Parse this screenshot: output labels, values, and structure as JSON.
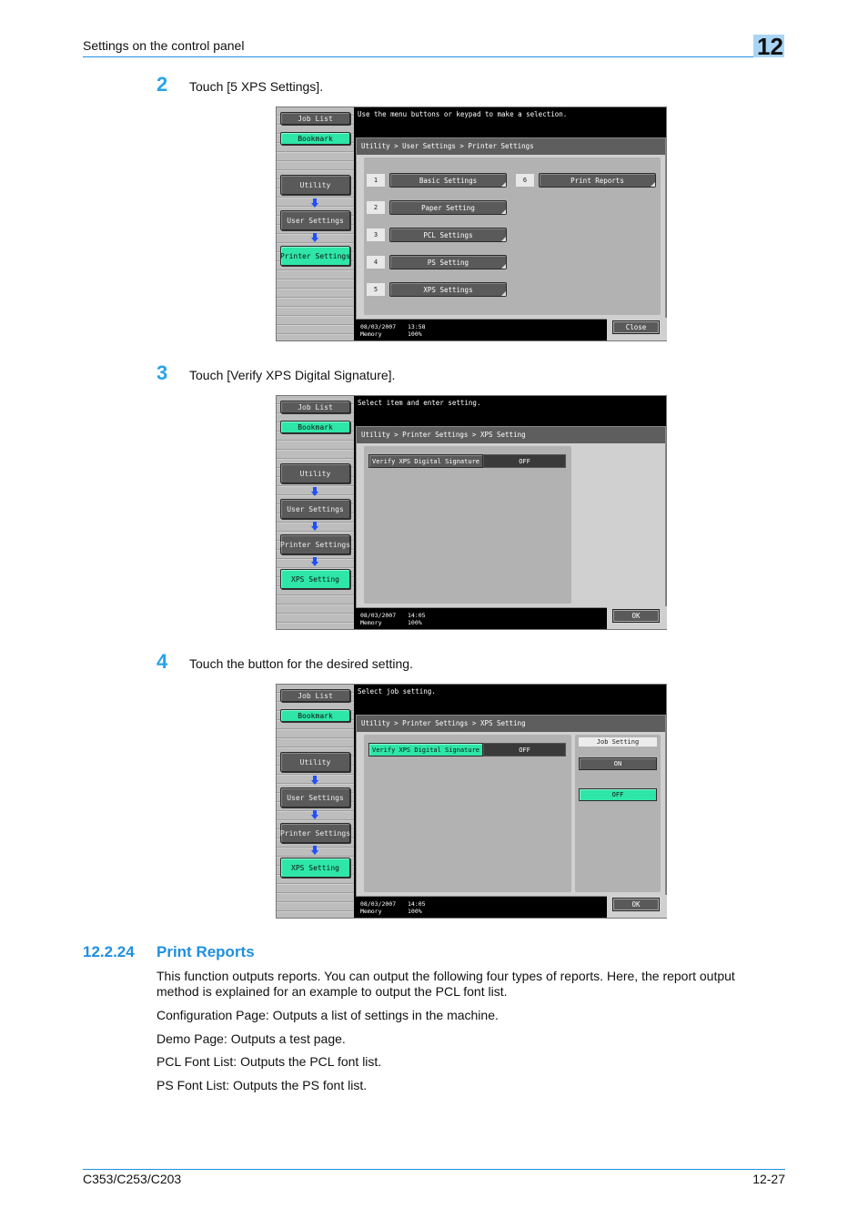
{
  "header": {
    "title": "Settings on the control panel",
    "chapter": "12"
  },
  "steps": [
    {
      "num": "2",
      "text": "Touch [5 XPS Settings]."
    },
    {
      "num": "3",
      "text": "Touch [Verify XPS Digital Signature]."
    },
    {
      "num": "4",
      "text": "Touch the button for the desired setting."
    }
  ],
  "screens": [
    {
      "message": "Use the menu buttons or keypad to make a selection.",
      "breadcrumb": "Utility > User Settings > Printer Settings",
      "sidebar": {
        "job_list": "Job List",
        "bookmark": "Bookmark",
        "path": [
          "Utility",
          "User Settings",
          "Printer Settings"
        ]
      },
      "menu": [
        {
          "num": "1",
          "label": "Basic Settings"
        },
        {
          "num": "2",
          "label": "Paper Setting"
        },
        {
          "num": "3",
          "label": "PCL Settings"
        },
        {
          "num": "4",
          "label": "PS Setting"
        },
        {
          "num": "5",
          "label": "XPS Settings"
        },
        {
          "num": "6",
          "label": "Print Reports"
        }
      ],
      "status": {
        "date": "08/03/2007",
        "time": "13:58",
        "memory_label": "Memory",
        "memory": "100%"
      },
      "action": "Close"
    },
    {
      "message": "Select item and enter setting.",
      "breadcrumb": "Utility > Printer Settings > XPS Setting",
      "sidebar": {
        "job_list": "Job List",
        "bookmark": "Bookmark",
        "path": [
          "Utility",
          "User Settings",
          "Printer Settings",
          "XPS Setting"
        ]
      },
      "setting": {
        "label": "Verify XPS Digital Signature",
        "value": "OFF"
      },
      "status": {
        "date": "08/03/2007",
        "time": "14:05",
        "memory_label": "Memory",
        "memory": "100%"
      },
      "action": "OK"
    },
    {
      "message": "Select job setting.",
      "breadcrumb": "Utility > Printer Settings > XPS Setting",
      "sidebar": {
        "job_list": "Job List",
        "bookmark": "Bookmark",
        "path": [
          "Utility",
          "User Settings",
          "Printer Settings",
          "XPS Setting"
        ]
      },
      "setting": {
        "label": "Verify XPS Digital Signature",
        "value": "OFF"
      },
      "job_setting": {
        "title": "Job Setting",
        "options": [
          "ON",
          "OFF"
        ],
        "selected": "OFF"
      },
      "status": {
        "date": "08/03/2007",
        "time": "14:05",
        "memory_label": "Memory",
        "memory": "100%"
      },
      "action": "OK"
    }
  ],
  "section": {
    "number": "12.2.24",
    "title": "Print Reports",
    "paragraphs": [
      "This function outputs reports. You can output the following four types of reports. Here, the report output method is explained for an example to output the PCL font list.",
      "Configuration Page: Outputs a list of settings in the machine.",
      "Demo Page: Outputs a test page.",
      "PCL Font List: Outputs the PCL font list.",
      "PS Font List: Outputs the PS font list."
    ]
  },
  "footer": {
    "model": "C353/C253/C203",
    "page": "12-27"
  },
  "colors": {
    "accent": "#1f8fe0",
    "step_number": "#29a3ea",
    "panel_highlight": "#2ee6a8"
  }
}
